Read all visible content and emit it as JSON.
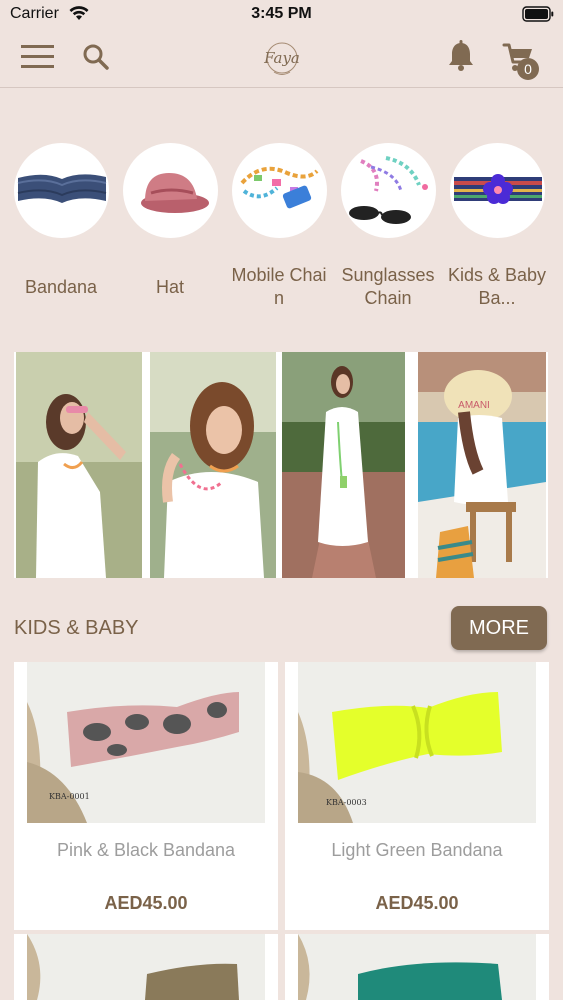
{
  "status_bar": {
    "carrier": "Carrier",
    "time": "3:45 PM"
  },
  "nav": {
    "menu_icon": "hamburger-icon",
    "search_icon": "search-icon",
    "logo_text": "Faya",
    "bell_icon": "bell-icon",
    "cart_icon": "cart-icon",
    "cart_count": "0"
  },
  "categories": [
    {
      "label": "Bandana",
      "icon": "bandana-thumbnail"
    },
    {
      "label": "Hat",
      "icon": "hat-thumbnail"
    },
    {
      "label": "Mobile Chain",
      "icon": "mobile-chain-thumbnail"
    },
    {
      "label": "Sunglasses Chain",
      "icon": "sunglasses-chain-thumbnail"
    },
    {
      "label": "Kids & Baby Ba...",
      "icon": "kids-baby-bandana-thumbnail"
    }
  ],
  "section": {
    "title": "KIDS & BABY",
    "more_label": "MORE"
  },
  "products": [
    {
      "name": "Pink & Black Bandana",
      "price": "AED45.00",
      "code": "KBA-0001"
    },
    {
      "name": "Light Green Bandana",
      "price": "AED45.00",
      "code": "KBA-0003"
    }
  ],
  "colors": {
    "background": "#efe3de",
    "accent": "#806a52",
    "label": "#7a6249",
    "product_name": "#9d9d9d"
  }
}
